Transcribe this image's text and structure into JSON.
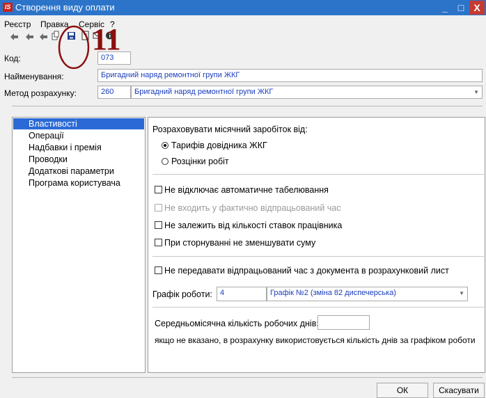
{
  "window": {
    "title": "Створення виду оплати",
    "logo_text": "IS",
    "minimize": "_",
    "maximize": "□",
    "close": "X"
  },
  "menu": [
    "Реєстр",
    "Правка",
    "Сервіс",
    "?"
  ],
  "toolbar": {
    "icons": [
      "arrow-icon",
      "arrow-icon",
      "arrow-icon",
      "copy-icon",
      "save-icon",
      "document-icon",
      "mail-icon",
      "info-icon"
    ]
  },
  "annotation": {
    "number": "11",
    "color": "#8b0f0f"
  },
  "form": {
    "code_label": "Код:",
    "code_value": "073",
    "name_label": "Найменування:",
    "name_value": "Бригадний наряд ремонтної групи ЖКГ",
    "method_label": "Метод розрахунку:",
    "method_code": "260",
    "method_value": "Бригадний наряд ремонтної групи ЖКГ"
  },
  "nav": {
    "items": [
      "Властивості",
      "Операції",
      "Надбавки і премія",
      "Проводки",
      "Додаткові параметри",
      "Програма користувача"
    ],
    "selected_index": 0
  },
  "properties": {
    "calc_label": "Розраховувати місячний заробіток від:",
    "radio_tariff": "Тарифів довідника ЖКГ",
    "radio_tariff_checked": true,
    "radio_rates": "Розцінки робіт",
    "radio_rates_checked": false,
    "cb_autotabel": "Не відключає автоматичне табелювання",
    "cb_actual_time": "Не входить у фактично відпрацьований час",
    "cb_rates_count": "Не залежить від кількості ставок працівника",
    "cb_storno": "При сторнуванні не зменшувати суму",
    "cb_transfer_time": "Не передавати відпрацьований час з документа в розрахунковий лист",
    "schedule_label": "Графік роботи:",
    "schedule_code": "4",
    "schedule_value": "Графік №2 (зміна 82 диспечерська)",
    "avg_days_label": "Середньомісячна кількість робочих днів:",
    "avg_days_value": "",
    "avg_days_note": "якщо не вказано, в розрахунку використовується кількість днів за графіком роботи"
  },
  "buttons": {
    "ok": "ОК",
    "cancel": "Скасувати"
  },
  "colors": {
    "titlebar": "#2c74c9",
    "selection": "#2b6ad6",
    "value_text": "#1a3dbb"
  }
}
